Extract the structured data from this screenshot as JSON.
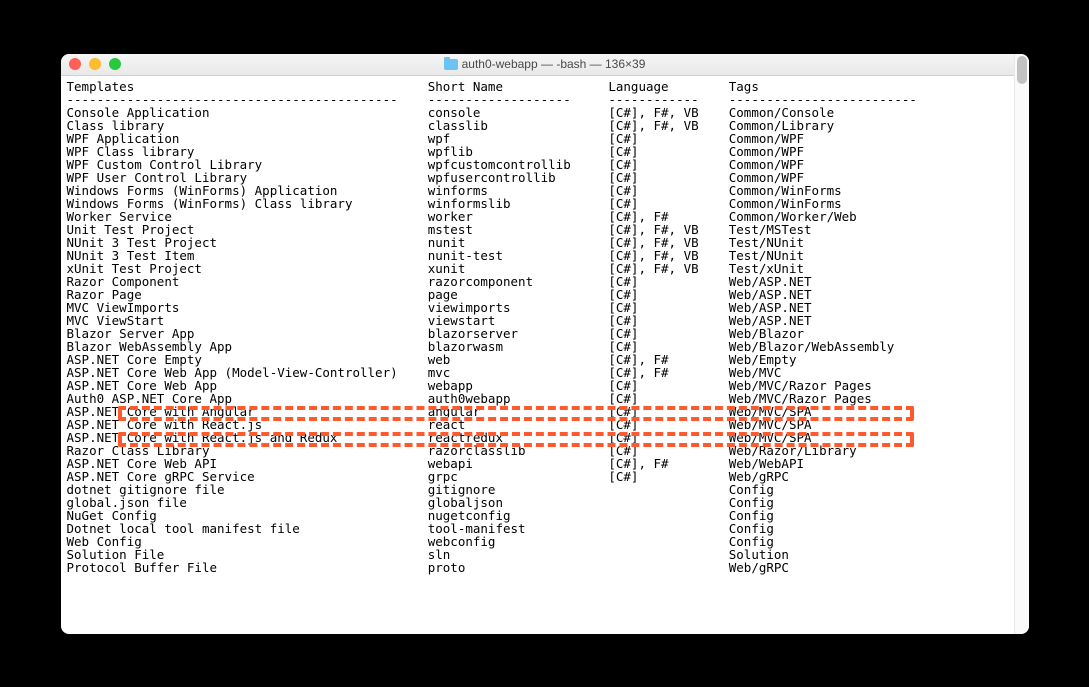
{
  "window": {
    "title": "auth0-webapp — -bash — 136×39"
  },
  "headers": {
    "templates": "Templates",
    "shortName": "Short Name",
    "language": "Language",
    "tags": "Tags"
  },
  "dividers": {
    "templates": "--------------------------------------------",
    "shortName": "-------------------",
    "language": "------------",
    "tags": "-------------------------"
  },
  "rows": [
    {
      "templates": "Console Application",
      "shortName": "console",
      "language": "[C#], F#, VB",
      "tags": "Common/Console"
    },
    {
      "templates": "Class library",
      "shortName": "classlib",
      "language": "[C#], F#, VB",
      "tags": "Common/Library"
    },
    {
      "templates": "WPF Application",
      "shortName": "wpf",
      "language": "[C#]",
      "tags": "Common/WPF"
    },
    {
      "templates": "WPF Class library",
      "shortName": "wpflib",
      "language": "[C#]",
      "tags": "Common/WPF"
    },
    {
      "templates": "WPF Custom Control Library",
      "shortName": "wpfcustomcontrollib",
      "language": "[C#]",
      "tags": "Common/WPF"
    },
    {
      "templates": "WPF User Control Library",
      "shortName": "wpfusercontrollib",
      "language": "[C#]",
      "tags": "Common/WPF"
    },
    {
      "templates": "Windows Forms (WinForms) Application",
      "shortName": "winforms",
      "language": "[C#]",
      "tags": "Common/WinForms"
    },
    {
      "templates": "Windows Forms (WinForms) Class library",
      "shortName": "winformslib",
      "language": "[C#]",
      "tags": "Common/WinForms"
    },
    {
      "templates": "Worker Service",
      "shortName": "worker",
      "language": "[C#], F#",
      "tags": "Common/Worker/Web"
    },
    {
      "templates": "Unit Test Project",
      "shortName": "mstest",
      "language": "[C#], F#, VB",
      "tags": "Test/MSTest"
    },
    {
      "templates": "NUnit 3 Test Project",
      "shortName": "nunit",
      "language": "[C#], F#, VB",
      "tags": "Test/NUnit"
    },
    {
      "templates": "NUnit 3 Test Item",
      "shortName": "nunit-test",
      "language": "[C#], F#, VB",
      "tags": "Test/NUnit"
    },
    {
      "templates": "xUnit Test Project",
      "shortName": "xunit",
      "language": "[C#], F#, VB",
      "tags": "Test/xUnit"
    },
    {
      "templates": "Razor Component",
      "shortName": "razorcomponent",
      "language": "[C#]",
      "tags": "Web/ASP.NET"
    },
    {
      "templates": "Razor Page",
      "shortName": "page",
      "language": "[C#]",
      "tags": "Web/ASP.NET"
    },
    {
      "templates": "MVC ViewImports",
      "shortName": "viewimports",
      "language": "[C#]",
      "tags": "Web/ASP.NET"
    },
    {
      "templates": "MVC ViewStart",
      "shortName": "viewstart",
      "language": "[C#]",
      "tags": "Web/ASP.NET"
    },
    {
      "templates": "Blazor Server App",
      "shortName": "blazorserver",
      "language": "[C#]",
      "tags": "Web/Blazor"
    },
    {
      "templates": "Blazor WebAssembly App",
      "shortName": "blazorwasm",
      "language": "[C#]",
      "tags": "Web/Blazor/WebAssembly"
    },
    {
      "templates": "ASP.NET Core Empty",
      "shortName": "web",
      "language": "[C#], F#",
      "tags": "Web/Empty"
    },
    {
      "templates": "ASP.NET Core Web App (Model-View-Controller)",
      "shortName": "mvc",
      "language": "[C#], F#",
      "tags": "Web/MVC"
    },
    {
      "templates": "ASP.NET Core Web App",
      "shortName": "webapp",
      "language": "[C#]",
      "tags": "Web/MVC/Razor Pages"
    },
    {
      "templates": "Auth0 ASP.NET Core App",
      "shortName": "auth0webapp",
      "language": "[C#]",
      "tags": "Web/MVC/Razor Pages"
    },
    {
      "templates": "ASP.NET Core with Angular",
      "shortName": "angular",
      "language": "[C#]",
      "tags": "Web/MVC/SPA"
    },
    {
      "templates": "ASP.NET Core with React.js",
      "shortName": "react",
      "language": "[C#]",
      "tags": "Web/MVC/SPA"
    },
    {
      "templates": "ASP.NET Core with React.js and Redux",
      "shortName": "reactredux",
      "language": "[C#]",
      "tags": "Web/MVC/SPA"
    },
    {
      "templates": "Razor Class Library",
      "shortName": "razorclasslib",
      "language": "[C#]",
      "tags": "Web/Razor/Library"
    },
    {
      "templates": "ASP.NET Core Web API",
      "shortName": "webapi",
      "language": "[C#], F#",
      "tags": "Web/WebAPI"
    },
    {
      "templates": "ASP.NET Core gRPC Service",
      "shortName": "grpc",
      "language": "[C#]",
      "tags": "Web/gRPC"
    },
    {
      "templates": "dotnet gitignore file",
      "shortName": "gitignore",
      "language": "",
      "tags": "Config"
    },
    {
      "templates": "global.json file",
      "shortName": "globaljson",
      "language": "",
      "tags": "Config"
    },
    {
      "templates": "NuGet Config",
      "shortName": "nugetconfig",
      "language": "",
      "tags": "Config"
    },
    {
      "templates": "Dotnet local tool manifest file",
      "shortName": "tool-manifest",
      "language": "",
      "tags": "Config"
    },
    {
      "templates": "Web Config",
      "shortName": "webconfig",
      "language": "",
      "tags": "Config"
    },
    {
      "templates": "Solution File",
      "shortName": "sln",
      "language": "",
      "tags": "Solution"
    },
    {
      "templates": "Protocol Buffer File",
      "shortName": "proto",
      "language": "",
      "tags": "Web/gRPC"
    }
  ],
  "columnWidths": {
    "templates": 48,
    "shortName": 24,
    "language": 16
  }
}
